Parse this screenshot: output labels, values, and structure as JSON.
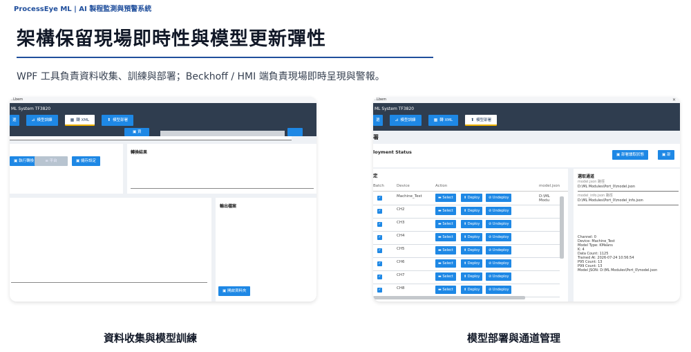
{
  "header": {
    "brand": "ProcessEye ML | AI 製程監測與預警系統",
    "title": "架構保留現場即時性與模型更新彈性",
    "subtitle": "WPF 工具負責資料收集、訓練與部署；Beckhoff / HMI 端負責現場即時呈現與警報。"
  },
  "left": {
    "caption": "資料收集與模型訓練",
    "window_title": "..Lbem",
    "system": "ML System TF3820",
    "tabs": [
      "選",
      "模型訓練",
      "轉 XML",
      "模型部署"
    ],
    "btn_top": "▣ 資",
    "btn_convert": "▣ 執行轉換",
    "btn_disabled": "≡ 平台",
    "btn_save": "▣ 儲存設定",
    "convert_result": "轉換結果",
    "output_file": "輸出檔案",
    "btn_open": "▣ 開啟資料夾"
  },
  "right": {
    "caption": "模型部署與通道管理",
    "window_title": "..Lbem",
    "system": "ML System TF3820",
    "tabs": [
      "選",
      "模型訓練",
      "轉 XML",
      "模型部署"
    ],
    "section": "署",
    "deploy_status": "loyment Status",
    "btn_read": "▣ 部署讀取狀態",
    "btn_more": "▣ 部",
    "table_title": "定",
    "columns": [
      "Batch",
      "Device",
      "Action",
      "model.json"
    ],
    "rows": [
      {
        "device": "Machine_Test",
        "path": "D:\\ML Modu"
      },
      {
        "device": "CH2",
        "path": ""
      },
      {
        "device": "CH3",
        "path": ""
      },
      {
        "device": "CH4",
        "path": ""
      },
      {
        "device": "CH5",
        "path": ""
      },
      {
        "device": "CH6",
        "path": ""
      },
      {
        "device": "CH7",
        "path": ""
      },
      {
        "device": "CH8",
        "path": ""
      }
    ],
    "actions": [
      "Select",
      "Deploy",
      "Undeploy"
    ],
    "channel_header": "選取通道",
    "model_json_label": "model.json 路徑",
    "model_json_path": "D:\\ML Modules\\Port_0\\model.json",
    "model_info_label": "model_info.json 路徑",
    "model_info_path": "D:\\ML Modules\\Port_0\\model_info.json",
    "info_lines": [
      "Channel: 0",
      "Device: Machine_Test",
      "Model Type: KMeans",
      "K: 4",
      "Data Count: 1125",
      "Trained At: 2026-07-24 10:56:54",
      "P95 Count: 13",
      "P99 Count: 13",
      "Model JSON: D:\\ML Modules\\Port_0\\model.json"
    ]
  }
}
